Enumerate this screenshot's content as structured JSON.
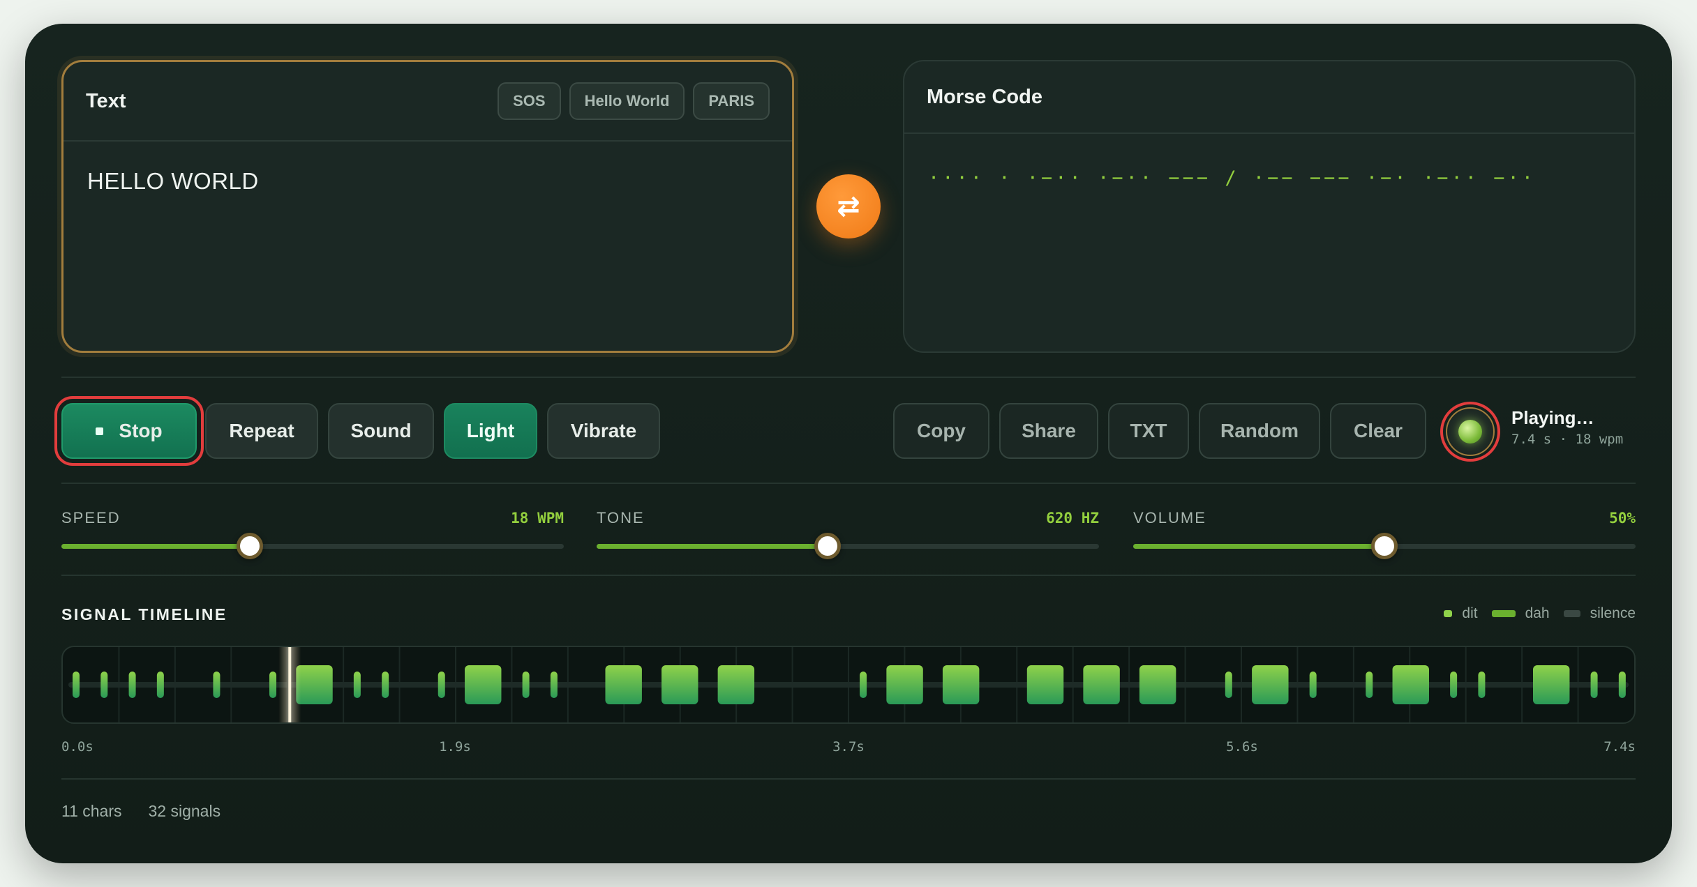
{
  "text_panel": {
    "title": "Text",
    "presets": [
      "SOS",
      "Hello World",
      "PARIS"
    ],
    "value": "HELLO WORLD"
  },
  "swap_icon": "swap-arrows-icon",
  "morse_panel": {
    "title": "Morse Code",
    "value": "···· · ·−·· ·−·· −−− / ·−− −−− ·−· ·−·· −··"
  },
  "controls": {
    "stop": "Stop",
    "repeat": "Repeat",
    "sound": "Sound",
    "light": "Light",
    "vibrate": "Vibrate",
    "copy": "Copy",
    "share": "Share",
    "txt": "TXT",
    "random": "Random",
    "clear": "Clear"
  },
  "status": {
    "label": "Playing…",
    "detail": "7.4 s · 18 wpm"
  },
  "sliders": {
    "speed": {
      "label": "SPEED",
      "value": "18 WPM",
      "level": 0.375
    },
    "tone": {
      "label": "TONE",
      "value": "620 HZ",
      "level": 0.46
    },
    "volume": {
      "label": "VOLUME",
      "value": "50%",
      "level": 0.5
    }
  },
  "timeline": {
    "title": "SIGNAL TIMELINE",
    "legend": {
      "dit": "dit",
      "dah": "dah",
      "silence": "silence"
    },
    "ticks": [
      "0.0s",
      "1.9s",
      "3.7s",
      "5.6s",
      "7.4s"
    ],
    "total_seconds": 7.4,
    "playhead_seconds": 1.05
  },
  "footer": {
    "chars": "11 chars",
    "signals": "32 signals"
  },
  "colors": {
    "accent_green": "#6bb02f",
    "morse_text": "#93cf3e",
    "active_button": "#19825c",
    "swap_orange": "#f07a16",
    "highlight_red": "#e23d3d"
  }
}
